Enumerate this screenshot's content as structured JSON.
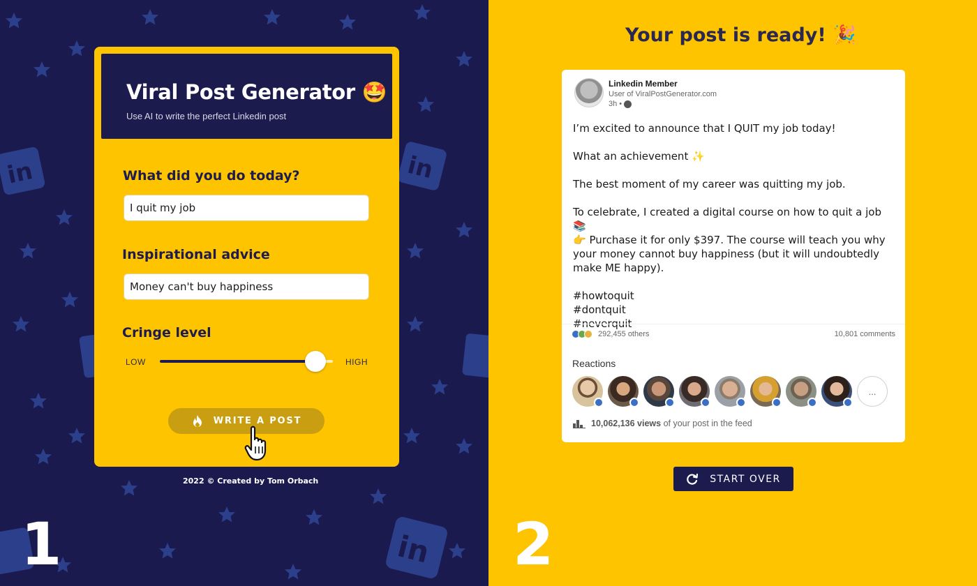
{
  "left_panel": {
    "step_number": "1",
    "card": {
      "title": "Viral Post Generator",
      "title_emoji": "🤩",
      "subtitle": "Use AI to write the perfect Linkedin post",
      "question1_label": "What did you do today?",
      "question1_value": "I quit my job",
      "question2_label": "Inspirational advice",
      "question2_value": "Money can't buy happiness",
      "cringe_label": "Cringe level",
      "slider_low_label": "LOW",
      "slider_high_label": "HIGH",
      "slider_value_fraction": 0.9,
      "write_button_label": "WRITE A POST",
      "write_button_icon": "flame-icon"
    },
    "footer": "2022 © Created by Tom Orbach",
    "colors": {
      "background": "#1b1a4f",
      "card": "#fec400",
      "decoration": "#2c3f8a"
    }
  },
  "right_panel": {
    "step_number": "2",
    "title": "Your post is ready! 🎉",
    "post": {
      "author_name": "Linkedin Member",
      "author_subtitle": "User of ViralPostGenerator.com",
      "time": "3h •",
      "body": [
        "I’m excited to announce that I QUIT my job today!",
        "What an achievement ✨",
        "The best moment of my career was quitting my job.",
        "To celebrate, I created a digital course on how to quit a job 📚\n👉 Purchase it for only $397. The course will teach you why your money cannot buy happiness (but it will undoubtedly make ME happy).",
        "#howtoquit\n#dontquit\n#neverquit"
      ],
      "reaction_count": "292,455 others",
      "comment_count": "10,801 comments",
      "reactions_label": "Reactions",
      "more_reactions": "...",
      "views_count": "10,062,136 views",
      "views_suffix": " of your post in the feed"
    },
    "start_over_label": "START OVER",
    "start_over_icon": "refresh-icon",
    "colors": {
      "background": "#fec400",
      "button": "#1c1b4e",
      "title": "#2a2752"
    }
  }
}
